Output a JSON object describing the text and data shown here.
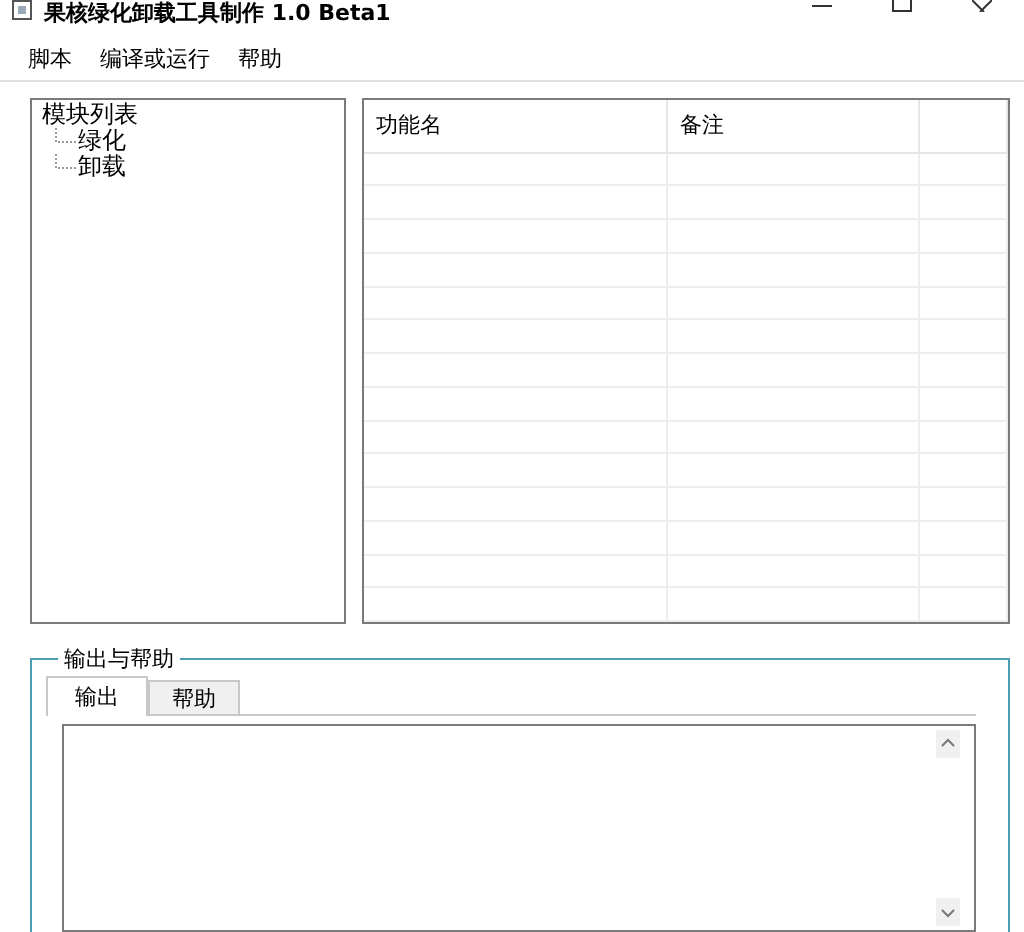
{
  "window": {
    "title": "果核绿化卸载工具制作 1.0 Beta1"
  },
  "menu": [
    "脚本",
    "编译或运行",
    "帮助"
  ],
  "tree": {
    "label": "模块列表",
    "children": [
      {
        "label": "绿化"
      },
      {
        "label": "卸载"
      }
    ]
  },
  "table": {
    "columns": [
      "功能名",
      "备注"
    ]
  },
  "output": {
    "title": "输出与帮助",
    "tabs": [
      {
        "label": "输出",
        "selected": true
      },
      {
        "label": "帮助",
        "selected": false
      }
    ]
  }
}
